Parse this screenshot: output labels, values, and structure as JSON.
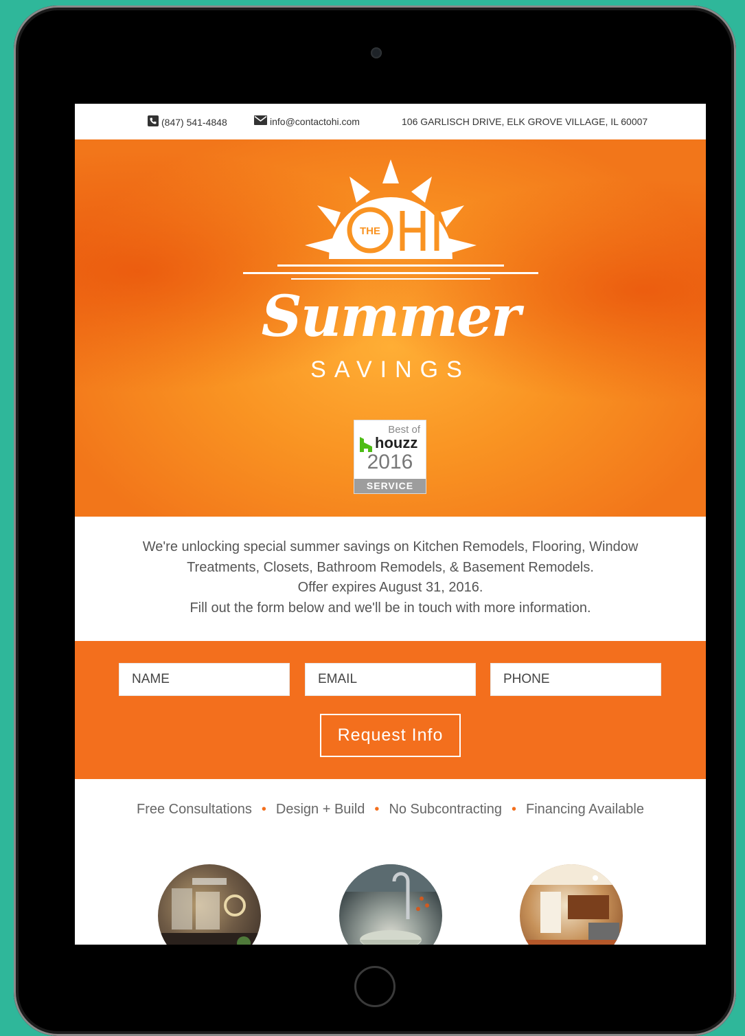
{
  "topbar": {
    "phone": "(847) 541-4848",
    "email": "info@contactohi.com",
    "address": "106 GARLISCH DRIVE, ELK GROVE VILLAGE, IL 60007"
  },
  "hero": {
    "logo_small": "THE",
    "logo_main": "OHI",
    "headline": "Summer",
    "subheadline": "SAVINGS",
    "badge": {
      "best_of": "Best of",
      "brand": "houzz",
      "year": "2016",
      "label": "SERVICE"
    }
  },
  "intro": {
    "line1": "We're unlocking special summer savings on Kitchen Remodels, Flooring, Window",
    "line2": "Treatments, Closets, Bathroom Remodels, & Basement Remodels.",
    "line3": "Offer expires August 31, 2016.",
    "line4": "Fill out the form below and we'll be in touch with more information."
  },
  "form": {
    "name_placeholder": "NAME",
    "email_placeholder": "EMAIL",
    "phone_placeholder": "PHONE",
    "submit_label": "Request Info"
  },
  "features": [
    "Free Consultations",
    "Design + Build",
    "No Subcontracting",
    "Financing Available"
  ],
  "colors": {
    "accent": "#f36f1d",
    "frame_background": "#2fb79a",
    "hero_orange": "#f99322"
  },
  "icons": {
    "phone": "phone-icon",
    "email": "envelope-icon"
  }
}
